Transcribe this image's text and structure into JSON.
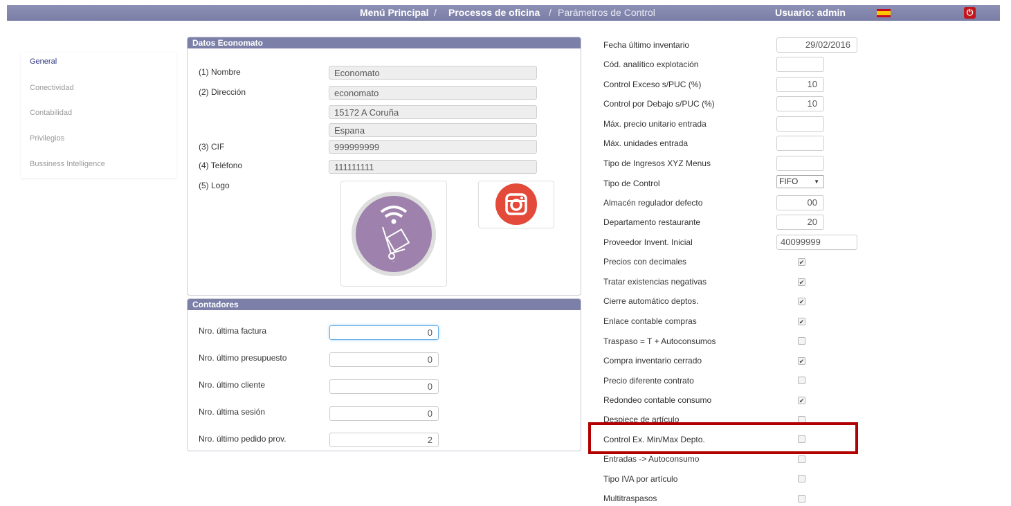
{
  "topbar": {
    "crumb1": "Menú Principal",
    "sep1": "/",
    "crumb2": "Procesos de oficina",
    "sep2": "/",
    "crumb3": "Parámetros de Control",
    "user": "Usuario: admin"
  },
  "sidebar": {
    "items": [
      {
        "label": "General"
      },
      {
        "label": "Conectividad"
      },
      {
        "label": "Contabilidad"
      },
      {
        "label": "Privilegios"
      },
      {
        "label": "Bussiness Intelligence"
      }
    ]
  },
  "datos": {
    "title": "Datos Economato",
    "nombre_label": "(1) Nombre",
    "nombre": "Economato",
    "direccion_label": "(2) Dirección",
    "direccion1": "economato",
    "direccion2": "15172 A Coruña",
    "direccion3": "Espana",
    "cif_label": "(3) CIF",
    "cif": "999999999",
    "telefono_label": "(4) Teléfono",
    "telefono": "111111111",
    "logo_label": "(5) Logo"
  },
  "contadores": {
    "title": "Contadores",
    "rows": [
      {
        "label": "Nro. última factura",
        "value": "0"
      },
      {
        "label": "Nro. último presupuesto",
        "value": "0"
      },
      {
        "label": "Nro. último cliente",
        "value": "0"
      },
      {
        "label": "Nro. última sesión",
        "value": "0"
      },
      {
        "label": "Nro. último pedido prov.",
        "value": "2"
      }
    ]
  },
  "settings": {
    "fields": [
      {
        "label": "Fecha último inventario",
        "value": "29/02/2016"
      },
      {
        "label": "Cód. analítico explotación",
        "value": ""
      },
      {
        "label": "Control Exceso s/PUC (%)",
        "value": "10"
      },
      {
        "label": "Control por Debajo s/PUC (%)",
        "value": "10"
      },
      {
        "label": "Máx. precio unitario entrada",
        "value": ""
      },
      {
        "label": "Máx. unidades entrada",
        "value": ""
      },
      {
        "label": "Tipo de Ingresos XYZ Menus",
        "value": ""
      },
      {
        "label": "Tipo de Control",
        "value": "FIFO"
      },
      {
        "label": "Almacén regulador defecto",
        "value": "00"
      },
      {
        "label": "Departamento restaurante",
        "value": "20"
      },
      {
        "label": "Proveedor Invent. Inicial",
        "value": "40099999"
      }
    ],
    "checks": [
      {
        "label": "Precios con decimales",
        "checked": true
      },
      {
        "label": "Tratar existencias negativas",
        "checked": true
      },
      {
        "label": "Cierre automático deptos.",
        "checked": true
      },
      {
        "label": "Enlace contable compras",
        "checked": true
      },
      {
        "label": "Traspaso = T + Autoconsumos",
        "checked": false
      },
      {
        "label": "Compra inventario cerrado",
        "checked": true
      },
      {
        "label": "Precio diferente contrato",
        "checked": false
      },
      {
        "label": "Redondeo contable consumo",
        "checked": true
      },
      {
        "label": "Despiece de artículo",
        "checked": false
      },
      {
        "label": "Control Ex. Min/Max Depto.",
        "checked": false
      },
      {
        "label": "Entradas -> Autoconsumo",
        "checked": false
      },
      {
        "label": "Tipo IVA por artículo",
        "checked": false
      },
      {
        "label": "Multitraspasos",
        "checked": false
      }
    ]
  },
  "colors": {
    "header": "#7c80a8",
    "highlight": "#b20000",
    "logo_purple": "#9e82ad",
    "instagram": "#e34a3a"
  },
  "icons": [
    "power-icon",
    "spain-flag-icon",
    "logo-image",
    "instagram-icon"
  ]
}
